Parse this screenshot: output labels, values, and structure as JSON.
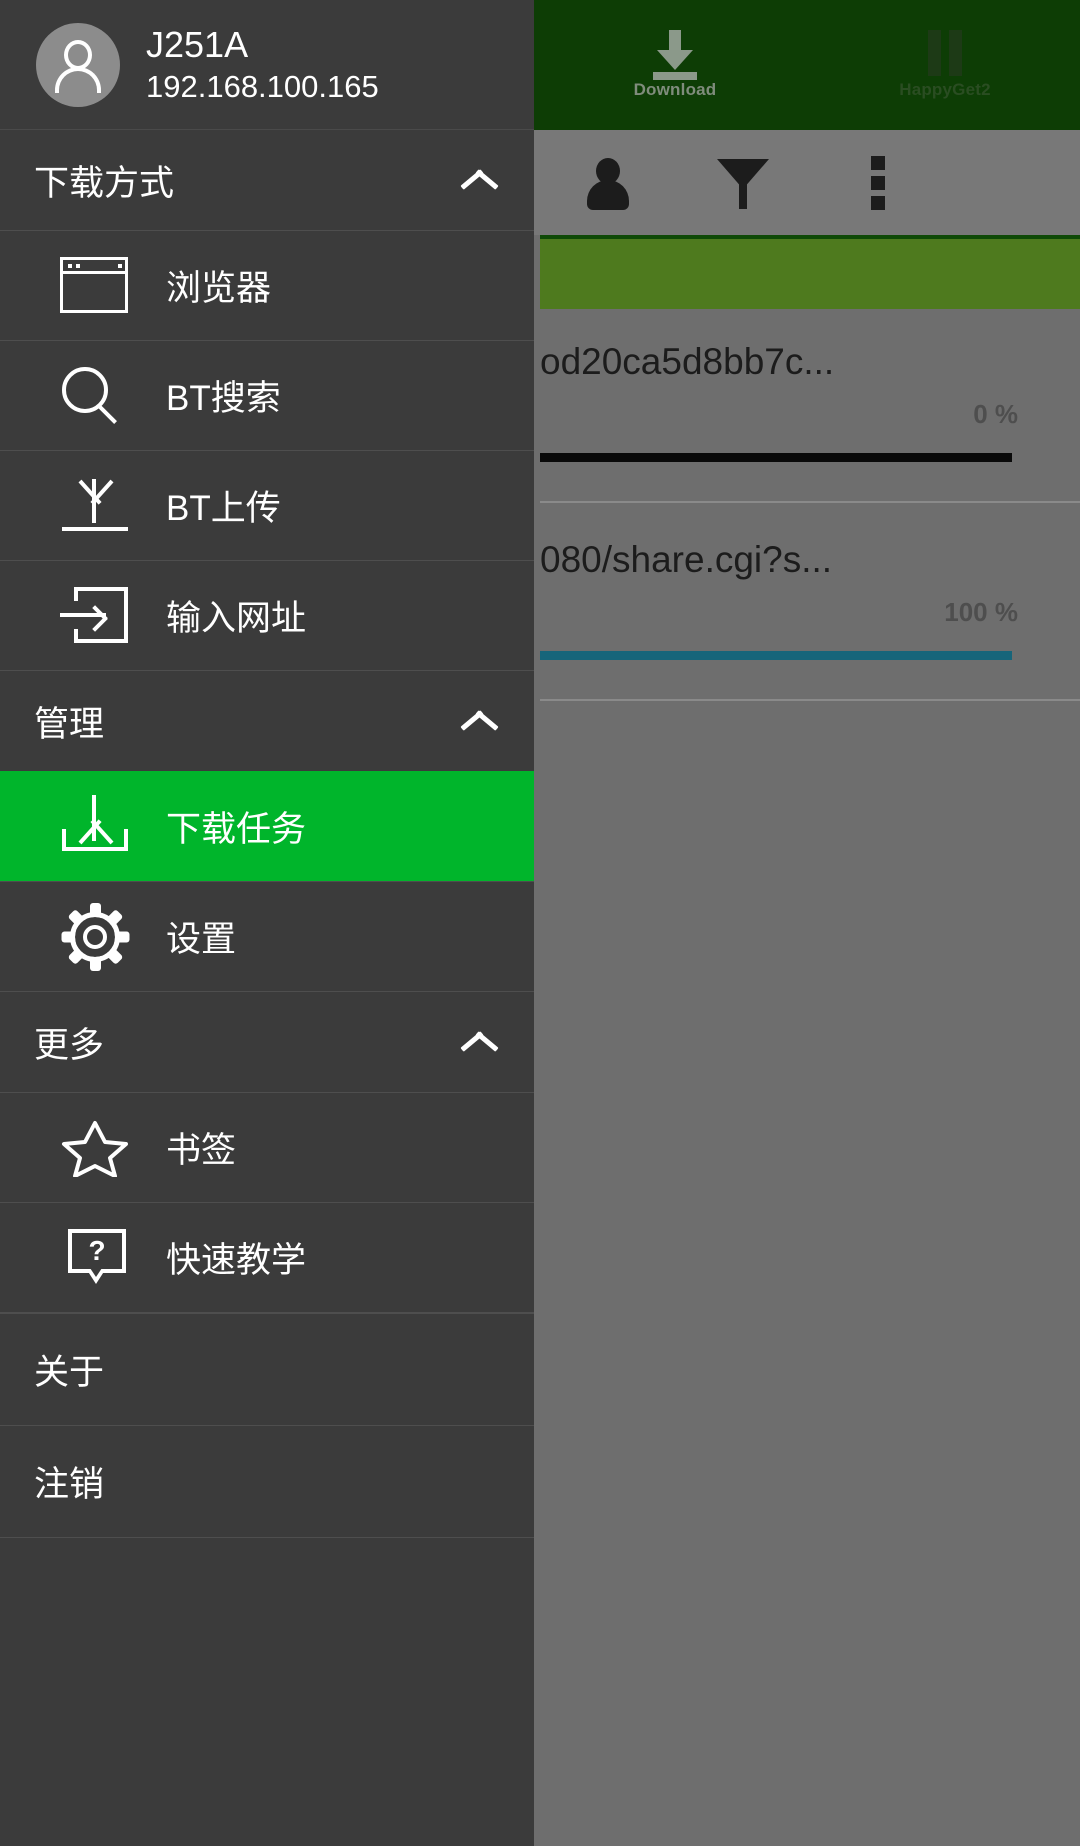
{
  "background_app": {
    "toolbar": {
      "tabs": [
        {
          "label": "Download",
          "icon": "download-arrow-icon",
          "state": "inactive"
        },
        {
          "label": "HappyGet2",
          "icon": "pause-bars-icon",
          "state": "active"
        }
      ]
    },
    "action_bar": {
      "icons": [
        "person-icon",
        "filter-funnel-icon",
        "overflow-menu-icon"
      ]
    },
    "tasks": [
      {
        "name": "od20ca5d8bb7c...",
        "percent": "0 %",
        "bar": "zero"
      },
      {
        "name": "080/share.cgi?s...",
        "percent": "100 %",
        "bar": "full"
      }
    ]
  },
  "drawer": {
    "user": {
      "name": "J251A",
      "ip": "192.168.100.165",
      "avatar_icon": "person-avatar-icon"
    },
    "sections": [
      {
        "title": "下载方式",
        "chevron": "chevron-up-icon",
        "items": [
          {
            "label": "浏览器",
            "icon": "browser-window-icon",
            "selected": false
          },
          {
            "label": "BT搜索",
            "icon": "magnifier-icon",
            "selected": false
          },
          {
            "label": "BT上传",
            "icon": "upload-arrow-icon",
            "selected": false
          },
          {
            "label": "输入网址",
            "icon": "enter-url-icon",
            "selected": false
          }
        ]
      },
      {
        "title": "管理",
        "chevron": "chevron-up-icon",
        "items": [
          {
            "label": "下载任务",
            "icon": "download-tray-icon",
            "selected": true
          },
          {
            "label": "设置",
            "icon": "gear-icon",
            "selected": false
          }
        ]
      },
      {
        "title": "更多",
        "chevron": "chevron-up-icon",
        "items": [
          {
            "label": "书签",
            "icon": "star-icon",
            "selected": false
          },
          {
            "label": "快速教学",
            "icon": "help-bubble-icon",
            "selected": false
          }
        ]
      }
    ],
    "plain_items": [
      {
        "label": "关于"
      },
      {
        "label": "注销"
      }
    ]
  },
  "colors": {
    "drawer_bg": "#3b3b3b",
    "selected_green": "#00b52b",
    "toolbar_green": "#0d3d05",
    "olive_band": "#4e7a1e",
    "progress_full": "#17657a",
    "progress_zero": "#0a0a0a",
    "scrim_gray": "#6e6e6e"
  }
}
